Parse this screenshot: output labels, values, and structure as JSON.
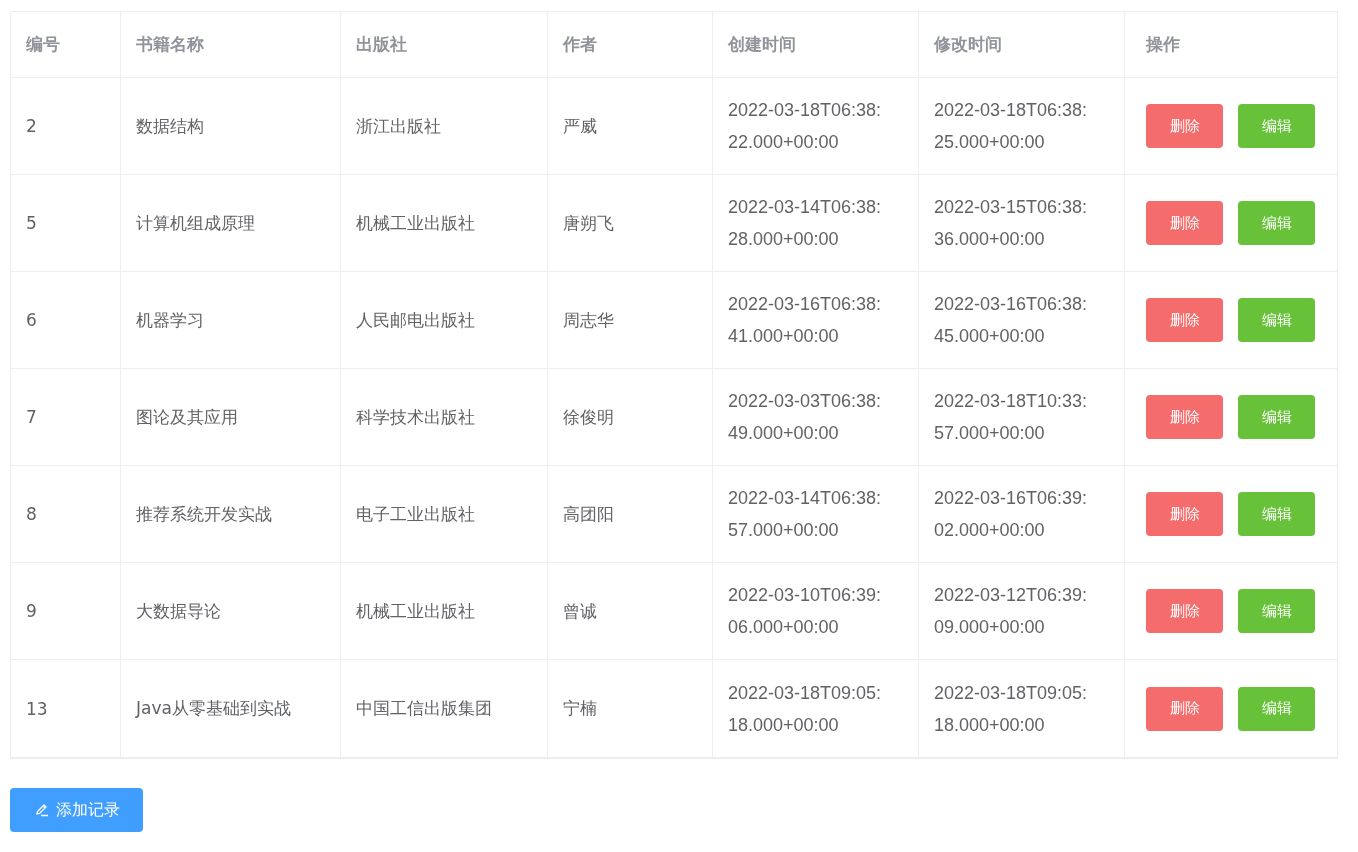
{
  "table": {
    "columns": [
      "编号",
      "书籍名称",
      "出版社",
      "作者",
      "创建时间",
      "修改时间",
      "操作"
    ],
    "rows": [
      {
        "id": "2",
        "title": "数据结构",
        "publisher": "浙江出版社",
        "author": "严威",
        "created": "2022-03-18T06:38:22.000+00:00",
        "modified": "2022-03-18T06:38:25.000+00:00",
        "actions": [
          {
            "label": "删除",
            "kind": "delete"
          },
          {
            "label": "编辑",
            "kind": "edit"
          }
        ]
      },
      {
        "id": "5",
        "title": "计算机组成原理",
        "publisher": "机械工业出版社",
        "author": "唐朔飞",
        "created": "2022-03-14T06:38:28.000+00:00",
        "modified": "2022-03-15T06:38:36.000+00:00",
        "actions": [
          {
            "label": "删除",
            "kind": "delete"
          },
          {
            "label": "编辑",
            "kind": "edit"
          }
        ]
      },
      {
        "id": "6",
        "title": "机器学习",
        "publisher": "人民邮电出版社",
        "author": "周志华",
        "created": "2022-03-16T06:38:41.000+00:00",
        "modified": "2022-03-16T06:38:45.000+00:00",
        "actions": [
          {
            "label": "删除",
            "kind": "delete"
          },
          {
            "label": "编辑",
            "kind": "edit"
          }
        ]
      },
      {
        "id": "7",
        "title": "图论及其应用",
        "publisher": "科学技术出版社",
        "author": "徐俊明",
        "created": "2022-03-03T06:38:49.000+00:00",
        "modified": "2022-03-18T10:33:57.000+00:00",
        "actions": [
          {
            "label": "删除",
            "kind": "delete"
          },
          {
            "label": "编辑",
            "kind": "edit"
          }
        ]
      },
      {
        "id": "8",
        "title": "推荐系统开发实战",
        "publisher": "电子工业出版社",
        "author": "高团阳",
        "created": "2022-03-14T06:38:57.000+00:00",
        "modified": "2022-03-16T06:39:02.000+00:00",
        "actions": [
          {
            "label": "删除",
            "kind": "delete"
          },
          {
            "label": "编辑",
            "kind": "edit"
          }
        ]
      },
      {
        "id": "9",
        "title": "大数据导论",
        "publisher": "机械工业出版社",
        "author": "曾诚",
        "created": "2022-03-10T06:39:06.000+00:00",
        "modified": "2022-03-12T06:39:09.000+00:00",
        "actions": [
          {
            "label": "删除",
            "kind": "delete"
          },
          {
            "label": "编辑",
            "kind": "edit"
          }
        ]
      },
      {
        "id": "13",
        "title": "Java从零基础到实战",
        "publisher": "中国工信出版集团",
        "author": "宁楠",
        "created": "2022-03-18T09:05:18.000+00:00",
        "modified": "2022-03-18T09:05:18.000+00:00",
        "actions": [
          {
            "label": "删除",
            "kind": "delete"
          },
          {
            "label": "编辑",
            "kind": "edit"
          }
        ]
      }
    ]
  },
  "add_button": {
    "label": "添加记录"
  }
}
